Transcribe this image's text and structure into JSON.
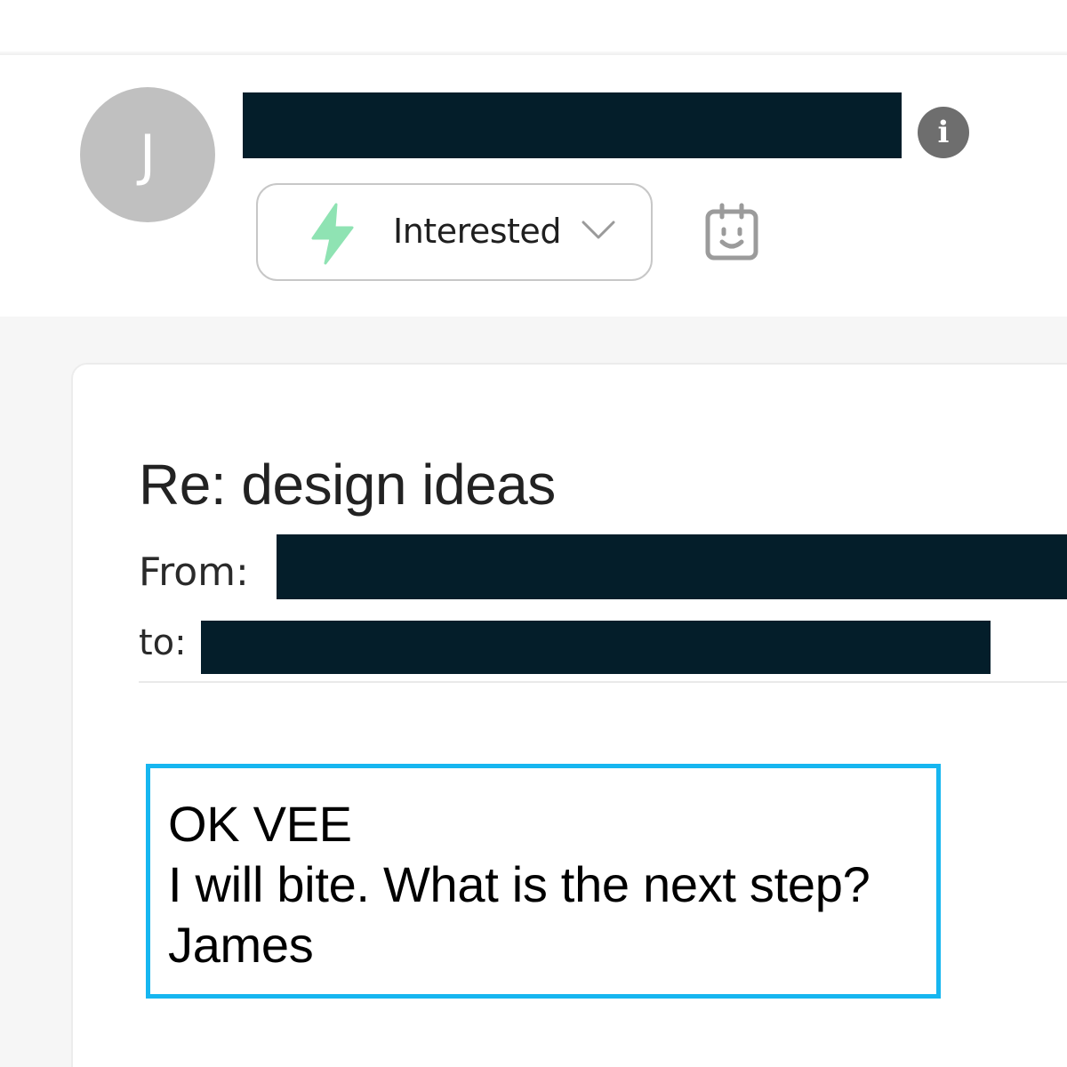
{
  "contact": {
    "avatar_initial": "J",
    "name": ""
  },
  "status": {
    "label": "Interested",
    "icon": "lightning-bolt-icon",
    "icon_color": "#8fe3b3",
    "options_icon": "chevron-down-icon"
  },
  "actions": {
    "info_icon": "info-icon",
    "calendar_icon": "calendar-icon"
  },
  "email": {
    "subject": "Re: design ideas",
    "from_label": "From:",
    "from_value": "",
    "to_label": "to:",
    "to_value": "",
    "body_lines": [
      "OK VEE",
      "I will bite. What is the next step?",
      "James"
    ],
    "highlight_color": "#16b6f0"
  },
  "colors": {
    "redaction": "#041e2a",
    "avatar_bg": "#c0c0c0"
  }
}
